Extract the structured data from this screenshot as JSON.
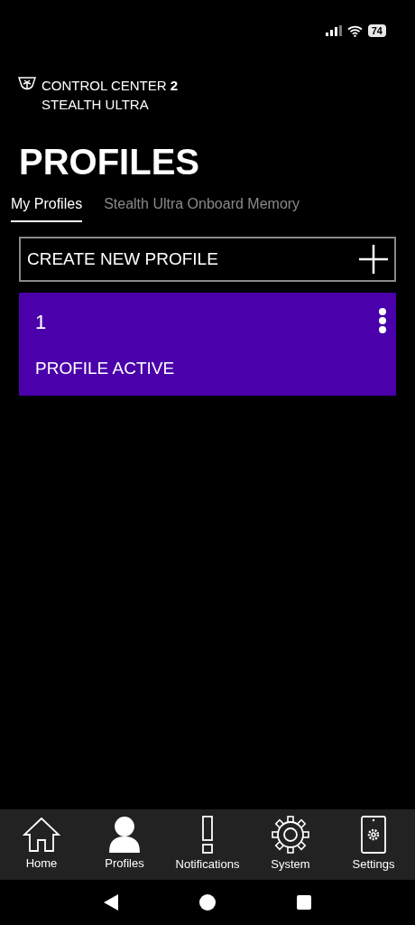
{
  "status_bar": {
    "battery": "74"
  },
  "app_header": {
    "title_line_1": "CONTROL CENTER",
    "title_badge": "2",
    "title_line_2": "STEALTH ULTRA"
  },
  "page_title": "PROFILES",
  "tabs": [
    {
      "label": "My Profiles",
      "selected": true
    },
    {
      "label": "Stealth Ultra Onboard Memory",
      "selected": false
    }
  ],
  "create_button": {
    "label": "CREATE NEW PROFILE"
  },
  "profiles": [
    {
      "name": "1",
      "status": "PROFILE ACTIVE",
      "active": true
    }
  ],
  "bottom_nav": [
    {
      "kind": "home",
      "label": "Home",
      "selected": false
    },
    {
      "kind": "profile",
      "label": "Profiles",
      "selected": true
    },
    {
      "kind": "alert",
      "label": "Notifications",
      "selected": false
    },
    {
      "kind": "gear",
      "label": "System",
      "selected": false
    },
    {
      "kind": "phone",
      "label": "Settings",
      "selected": false
    }
  ]
}
